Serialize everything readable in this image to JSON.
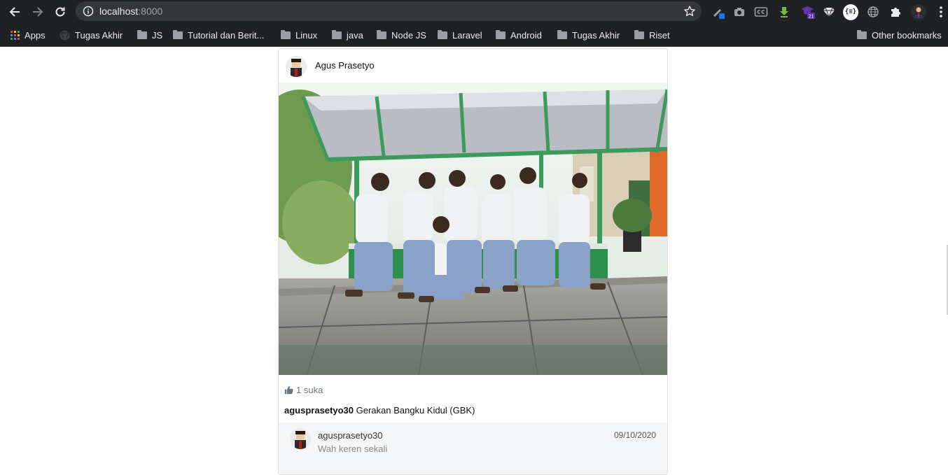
{
  "browser": {
    "url_host": "localhost",
    "url_port": ":8000",
    "bookmarks": [
      {
        "label": "Apps",
        "icon": "apps-grid-icon"
      },
      {
        "label": "Tugas Akhir",
        "icon": "github-icon"
      },
      {
        "label": "JS",
        "icon": "folder-icon"
      },
      {
        "label": "Tutorial dan Berit...",
        "icon": "folder-icon"
      },
      {
        "label": "Linux",
        "icon": "folder-icon"
      },
      {
        "label": "java",
        "icon": "folder-icon"
      },
      {
        "label": "Node JS",
        "icon": "folder-icon"
      },
      {
        "label": "Laravel",
        "icon": "folder-icon"
      },
      {
        "label": "Android",
        "icon": "folder-icon"
      },
      {
        "label": "Tugas Akhir",
        "icon": "folder-icon"
      },
      {
        "label": "Riset",
        "icon": "folder-icon"
      }
    ],
    "other_bookmarks": "Other bookmarks",
    "extension_badge": "21",
    "extension_json_label": "{≡}"
  },
  "post": {
    "author_name": "Agus Prasetyo",
    "likes_text": "1 suka",
    "caption_user": "agusprasetyo30",
    "caption_text": " Gerakan Bangku Kidul (GBK)",
    "comments": [
      {
        "user": "agusprasetyo30",
        "text": "Wah keren sekali",
        "date": "09/10/2020"
      }
    ]
  },
  "colors": {
    "chrome_bg": "#202124",
    "omnibox_bg": "#35363a",
    "comment_bg": "#f5f6f7",
    "canopy_green": "#3d9a5c"
  }
}
